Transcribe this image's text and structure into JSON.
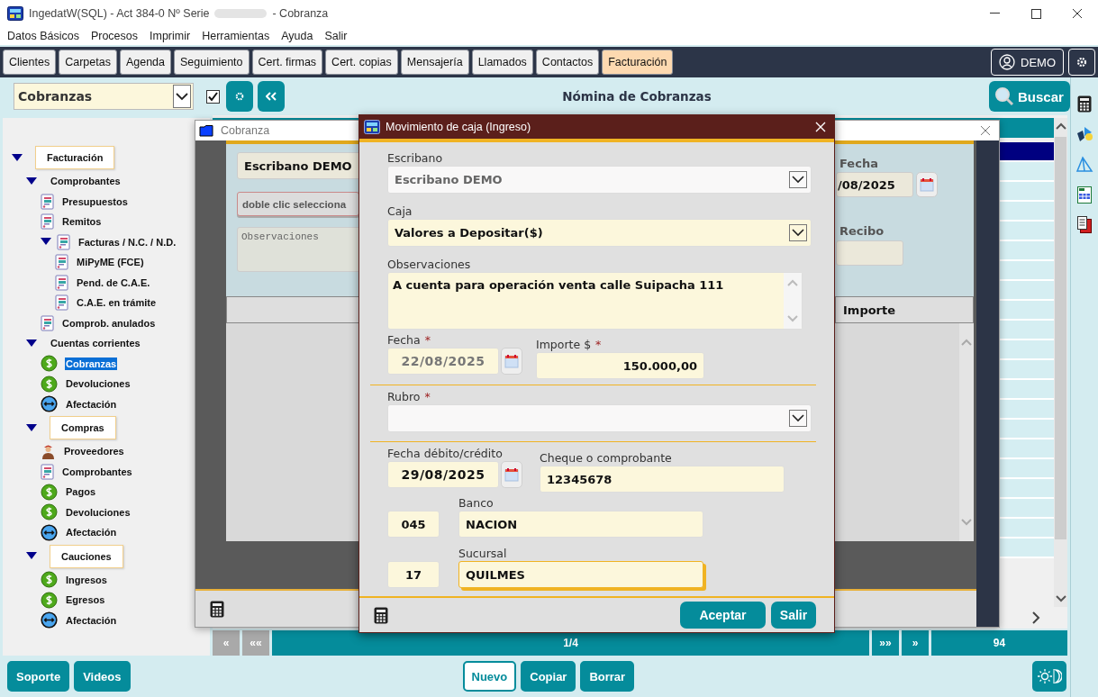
{
  "window": {
    "title": "IngedatW(SQL) - Act 384-0 Nº Serie",
    "title_end": "- Cobranza"
  },
  "menu": [
    "Datos Básicos",
    "Procesos",
    "Imprimir",
    "Herramientas",
    "Ayuda",
    "Salir"
  ],
  "toolbar": {
    "tabs": [
      {
        "label": "Clientes",
        "selected": false
      },
      {
        "label": "Carpetas",
        "selected": false
      },
      {
        "label": "Agenda",
        "selected": false
      },
      {
        "label": "Seguimiento",
        "selected": false
      },
      {
        "label": "Cert. firmas",
        "selected": false
      },
      {
        "label": "Cert. copias",
        "selected": false
      },
      {
        "label": "Mensajería",
        "selected": false
      },
      {
        "label": "Llamados",
        "selected": false
      },
      {
        "label": "Contactos",
        "selected": false
      },
      {
        "label": "Facturación",
        "selected": true
      }
    ],
    "user": "DEMO"
  },
  "header": {
    "module": "Cobranzas",
    "show_all": true,
    "title": "Nómina de Cobranzas",
    "search": "Buscar"
  },
  "tree": [
    {
      "label": "Facturación",
      "kind": "group",
      "selected": false,
      "expanded": true,
      "children": [
        {
          "label": "Comprobantes",
          "kind": "folder",
          "selected": false,
          "expanded": true,
          "children": [
            {
              "label": "Presupuestos",
              "kind": "doc",
              "selected": false
            },
            {
              "label": "Remitos",
              "kind": "doc",
              "selected": false
            },
            {
              "label": "Facturas / N.C. / N.D.",
              "kind": "doc",
              "selected": false,
              "expanded": true,
              "children": [
                {
                  "label": "MiPyME (FCE)",
                  "kind": "doc",
                  "selected": false
                },
                {
                  "label": "Pend. de C.A.E.",
                  "kind": "doc",
                  "selected": false
                },
                {
                  "label": "C.A.E. en trámite",
                  "kind": "doc",
                  "selected": false
                }
              ]
            },
            {
              "label": "Comprob. anulados",
              "kind": "doc",
              "selected": false
            }
          ]
        },
        {
          "label": "Cuentas corrientes",
          "kind": "folder",
          "selected": false,
          "expanded": true,
          "children": [
            {
              "label": "Cobranzas",
              "kind": "money",
              "selected": true
            },
            {
              "label": "Devoluciones",
              "kind": "money",
              "selected": false
            },
            {
              "label": "Afectación",
              "kind": "link",
              "selected": false
            }
          ]
        },
        {
          "label": "Compras",
          "kind": "group",
          "selected": false,
          "expanded": true,
          "children": [
            {
              "label": "Proveedores",
              "kind": "person",
              "selected": false
            },
            {
              "label": "Comprobantes",
              "kind": "doc",
              "selected": false
            },
            {
              "label": "Pagos",
              "kind": "money",
              "selected": false
            },
            {
              "label": "Devoluciones",
              "kind": "money",
              "selected": false
            },
            {
              "label": "Afectación",
              "kind": "link",
              "selected": false
            }
          ]
        },
        {
          "label": "Cauciones",
          "kind": "group",
          "selected": false,
          "expanded": true,
          "children": [
            {
              "label": "Ingresos",
              "kind": "money",
              "selected": false
            },
            {
              "label": "Egresos",
              "kind": "money",
              "selected": false
            },
            {
              "label": "Afectación",
              "kind": "link",
              "selected": false
            }
          ]
        }
      ]
    }
  ],
  "list": {
    "rows": [
      {
        "selected": true
      },
      {
        "selected": false
      },
      {
        "selected": false
      },
      {
        "selected": false
      },
      {
        "selected": false
      },
      {
        "selected": false
      },
      {
        "selected": false
      },
      {
        "selected": false
      },
      {
        "selected": false
      },
      {
        "selected": false
      },
      {
        "selected": false
      },
      {
        "selected": false
      },
      {
        "selected": false
      },
      {
        "selected": false
      },
      {
        "selected": false
      },
      {
        "selected": false
      },
      {
        "selected": false
      },
      {
        "selected": false
      },
      {
        "selected": false
      },
      {
        "selected": false
      },
      {
        "selected": false
      }
    ]
  },
  "pager": {
    "buttons_left": [
      {
        "label": "«",
        "disabled": true
      },
      {
        "label": "««",
        "disabled": true
      }
    ],
    "page": "1/4",
    "buttons_right": [
      {
        "label": "»»",
        "disabled": false
      },
      {
        "label": "»",
        "disabled": false
      }
    ],
    "count": "94"
  },
  "cobranza": {
    "title": "Cobranza",
    "escribano": "Escribano DEMO",
    "selector_hint": "doble clic selecciona",
    "observaciones_placeholder": "Observaciones",
    "fecha_label": "Fecha",
    "fecha": "/08/2025",
    "recibo_label": "Recibo",
    "column": "Importe"
  },
  "dialog": {
    "title": "Movimiento de caja (Ingreso)",
    "escribano": {
      "label": "Escribano",
      "value": "Escribano DEMO",
      "disabled": true
    },
    "caja": {
      "label": "Caja",
      "value": "Valores a Depositar($)",
      "disabled": false
    },
    "observaciones": {
      "label": "Observaciones",
      "value": "A cuenta para operación venta calle Suipacha 111"
    },
    "fecha": {
      "label": "Fecha",
      "required_mark": "*",
      "value": "22/08/2025",
      "disabled": true
    },
    "importe": {
      "label": "Importe $",
      "required_mark": "*",
      "value": "150.000,00"
    },
    "rubro": {
      "label": "Rubro",
      "required_mark": "*"
    },
    "fecha_debito": {
      "label": "Fecha débito/crédito",
      "value": "29/08/2025",
      "disabled": false
    },
    "cheque": {
      "label": "Cheque o comprobante",
      "value": "12345678"
    },
    "banco": {
      "label": "Banco",
      "code": "045",
      "value": "NACION",
      "focused": false
    },
    "sucursal": {
      "label": "Sucursal",
      "code": "17",
      "value": "QUILMES",
      "focused": true
    },
    "buttons": [
      "Aceptar",
      "Salir"
    ]
  },
  "footer": {
    "left": [
      "Soporte",
      "Videos"
    ],
    "actions": [
      {
        "label": "Nuevo",
        "focused": true
      },
      {
        "label": "Copiar",
        "focused": false
      },
      {
        "label": "Borrar",
        "focused": false
      }
    ]
  }
}
